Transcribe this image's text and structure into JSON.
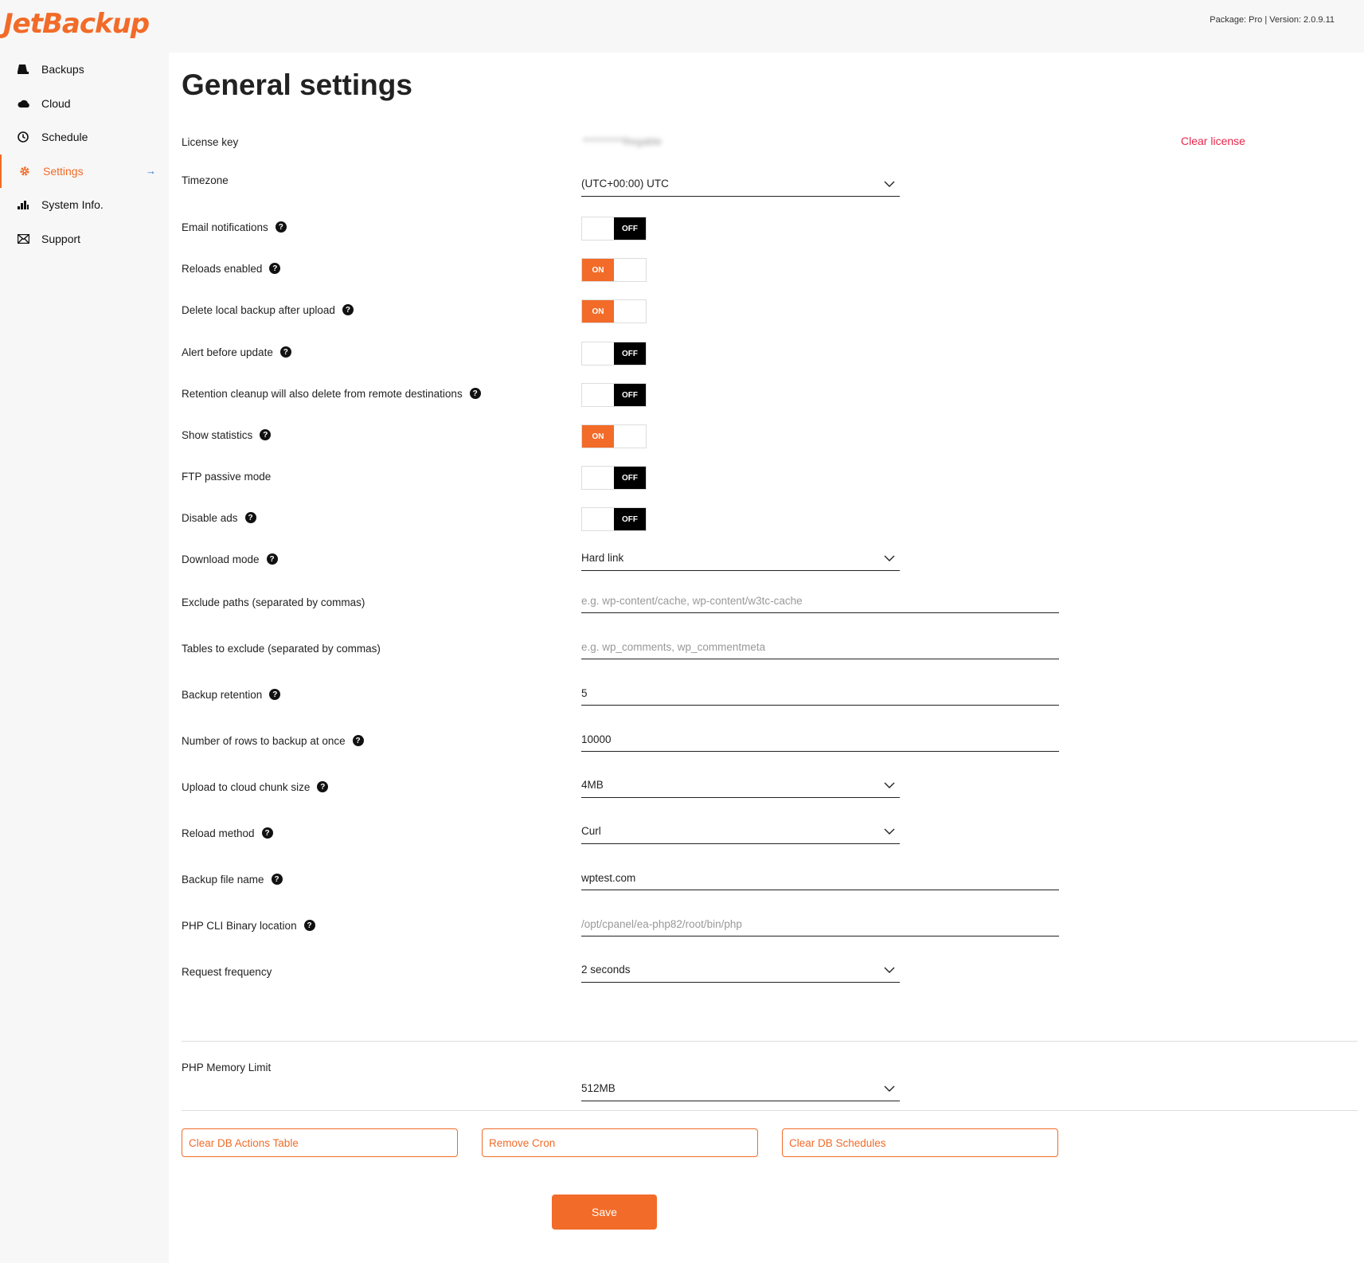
{
  "header": {
    "logo": "JetBackup",
    "package_info": "Package: Pro | Version: 2.0.9.11"
  },
  "sidebar": {
    "items": [
      {
        "label": "Backups",
        "icon": "drive-icon"
      },
      {
        "label": "Cloud",
        "icon": "cloud-icon"
      },
      {
        "label": "Schedule",
        "icon": "clock-icon"
      },
      {
        "label": "Settings",
        "icon": "gear-icon",
        "active": true
      },
      {
        "label": "System Info.",
        "icon": "chart-icon"
      },
      {
        "label": "Support",
        "icon": "envelope-icon"
      }
    ]
  },
  "page": {
    "title": "General settings"
  },
  "colors": {
    "accent": "#f26b28",
    "danger": "#e8264b"
  },
  "settings": {
    "license": {
      "label": "License key",
      "value": "**********Regable",
      "clear": "Clear license"
    },
    "timezone": {
      "label": "Timezone",
      "value": "(UTC+00:00) UTC"
    },
    "email_notifications": {
      "label": "Email notifications",
      "state": "OFF"
    },
    "reloads_enabled": {
      "label": "Reloads enabled",
      "state": "ON"
    },
    "delete_local": {
      "label": "Delete local backup after upload",
      "state": "ON"
    },
    "alert_update": {
      "label": "Alert before update",
      "state": "OFF"
    },
    "retention_cleanup": {
      "label": "Retention cleanup will also delete from remote destinations",
      "state": "OFF"
    },
    "show_statistics": {
      "label": "Show statistics",
      "state": "ON"
    },
    "ftp_passive": {
      "label": "FTP passive mode",
      "state": "OFF"
    },
    "disable_ads": {
      "label": "Disable ads",
      "state": "OFF"
    },
    "download_mode": {
      "label": "Download mode",
      "value": "Hard link"
    },
    "exclude_paths": {
      "label": "Exclude paths (separated by commas)",
      "placeholder": "e.g. wp-content/cache, wp-content/w3tc-cache"
    },
    "tables_exclude": {
      "label": "Tables to exclude (separated by commas)",
      "placeholder": "e.g. wp_comments, wp_commentmeta"
    },
    "backup_retention": {
      "label": "Backup retention",
      "value": "5"
    },
    "rows_once": {
      "label": "Number of rows to backup at once",
      "value": "10000"
    },
    "chunk_size": {
      "label": "Upload to cloud chunk size",
      "value": "4MB"
    },
    "reload_method": {
      "label": "Reload method",
      "value": "Curl"
    },
    "backup_file_name": {
      "label": "Backup file name",
      "value": "wptest.com"
    },
    "php_cli": {
      "label": "PHP CLI Binary location",
      "placeholder": "/opt/cpanel/ea-php82/root/bin/php"
    },
    "request_frequency": {
      "label": "Request frequency",
      "value": "2 seconds"
    },
    "php_memory": {
      "label": "PHP Memory Limit",
      "value": "512MB"
    }
  },
  "actions": {
    "clear_db_actions": "Clear DB Actions Table",
    "remove_cron": "Remove Cron",
    "clear_db_schedules": "Clear DB Schedules",
    "save": "Save"
  },
  "glyphs": {
    "on": "ON",
    "off": "OFF",
    "help": "?",
    "chevron": "⌵",
    "arrow": "→"
  }
}
